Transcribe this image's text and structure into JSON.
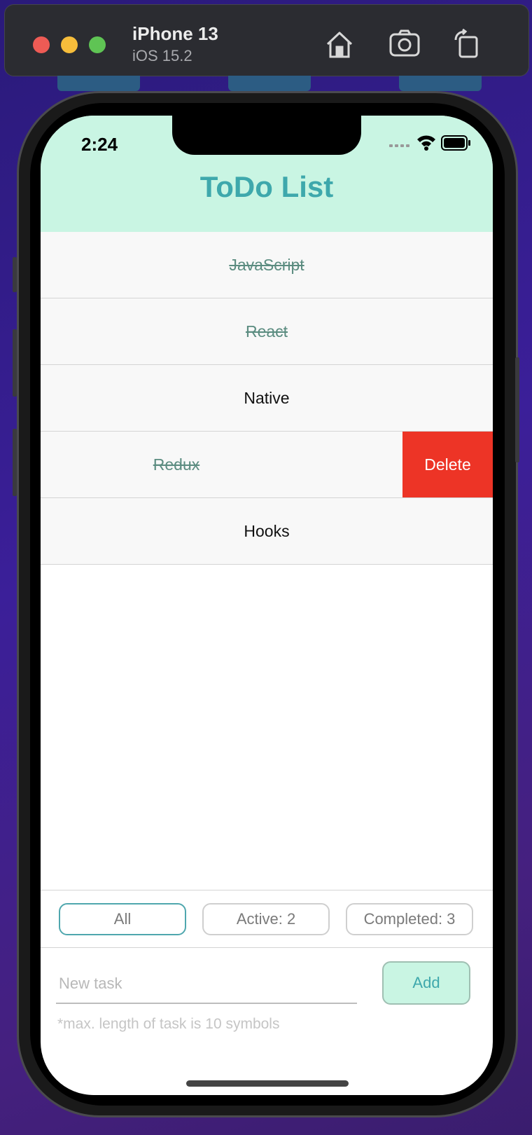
{
  "simulator": {
    "device_name": "iPhone 13",
    "os_version": "iOS 15.2",
    "icons": [
      "home-icon",
      "screenshot-icon",
      "rotate-icon"
    ]
  },
  "status_bar": {
    "time": "2:24"
  },
  "header": {
    "title": "ToDo List"
  },
  "tasks": [
    {
      "label": "JavaScript",
      "completed": true
    },
    {
      "label": "React",
      "completed": true
    },
    {
      "label": "Native",
      "completed": false
    },
    {
      "label": "Redux",
      "completed": true,
      "swiped": true
    },
    {
      "label": "Hooks",
      "completed": false
    }
  ],
  "row_action": {
    "delete_label": "Delete",
    "color": "#ed3426"
  },
  "filters": {
    "all": "All",
    "active": "Active: 2",
    "completed": "Completed: 3",
    "selected": "all"
  },
  "new_task": {
    "placeholder": "New task",
    "value": "",
    "add_label": "Add",
    "hint": "*max. length of task is 10 symbols"
  },
  "colors": {
    "accent": "#3ea8ac",
    "header_bg": "#c9f5e3",
    "completed_text": "#5b8c80"
  }
}
